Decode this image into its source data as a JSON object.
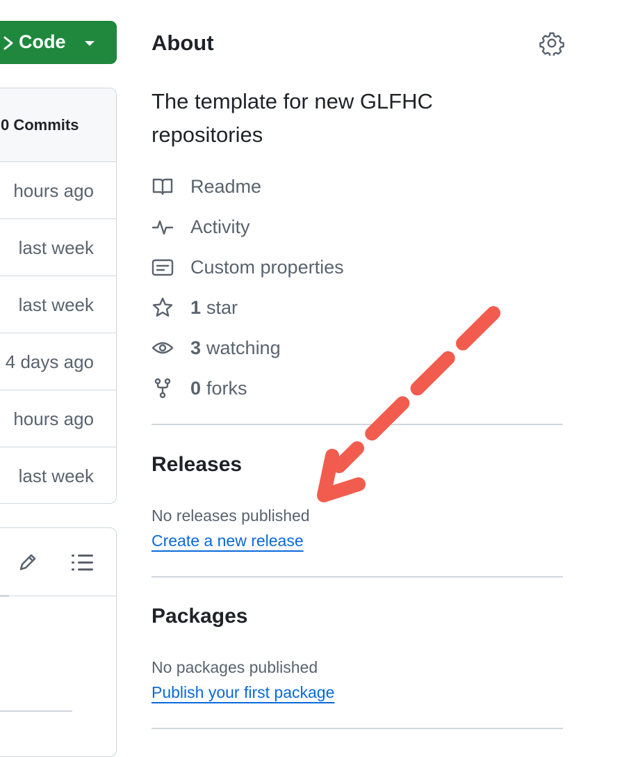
{
  "code_button": {
    "label": "Code"
  },
  "commits": {
    "header": "0 Commits",
    "rows": [
      {
        "time": "hours ago"
      },
      {
        "time": "last week"
      },
      {
        "time": "last week"
      },
      {
        "time": "4 days ago"
      },
      {
        "time": "hours ago"
      },
      {
        "time": "last week"
      }
    ]
  },
  "about": {
    "title": "About",
    "description": "The template for new GLFHC repositories",
    "links": [
      {
        "icon": "book-icon",
        "label": "Readme"
      },
      {
        "icon": "pulse-icon",
        "label": "Activity"
      },
      {
        "icon": "note-icon",
        "label": "Custom properties"
      }
    ],
    "stats": {
      "stars": {
        "icon": "star-icon",
        "count": "1",
        "label": "star"
      },
      "watching": {
        "icon": "eye-icon",
        "count": "3",
        "label": "watching"
      },
      "forks": {
        "icon": "fork-icon",
        "count": "0",
        "label": "forks"
      }
    }
  },
  "releases": {
    "title": "Releases",
    "empty_text": "No releases published",
    "link": "Create a new release"
  },
  "packages": {
    "title": "Packages",
    "empty_text": "No packages published",
    "link": "Publish your first package"
  },
  "colors": {
    "code_button": "#1f883d",
    "link": "#0969da",
    "muted": "#59636e",
    "border": "#d0d7de",
    "annotation_arrow": "#f25c4f"
  }
}
